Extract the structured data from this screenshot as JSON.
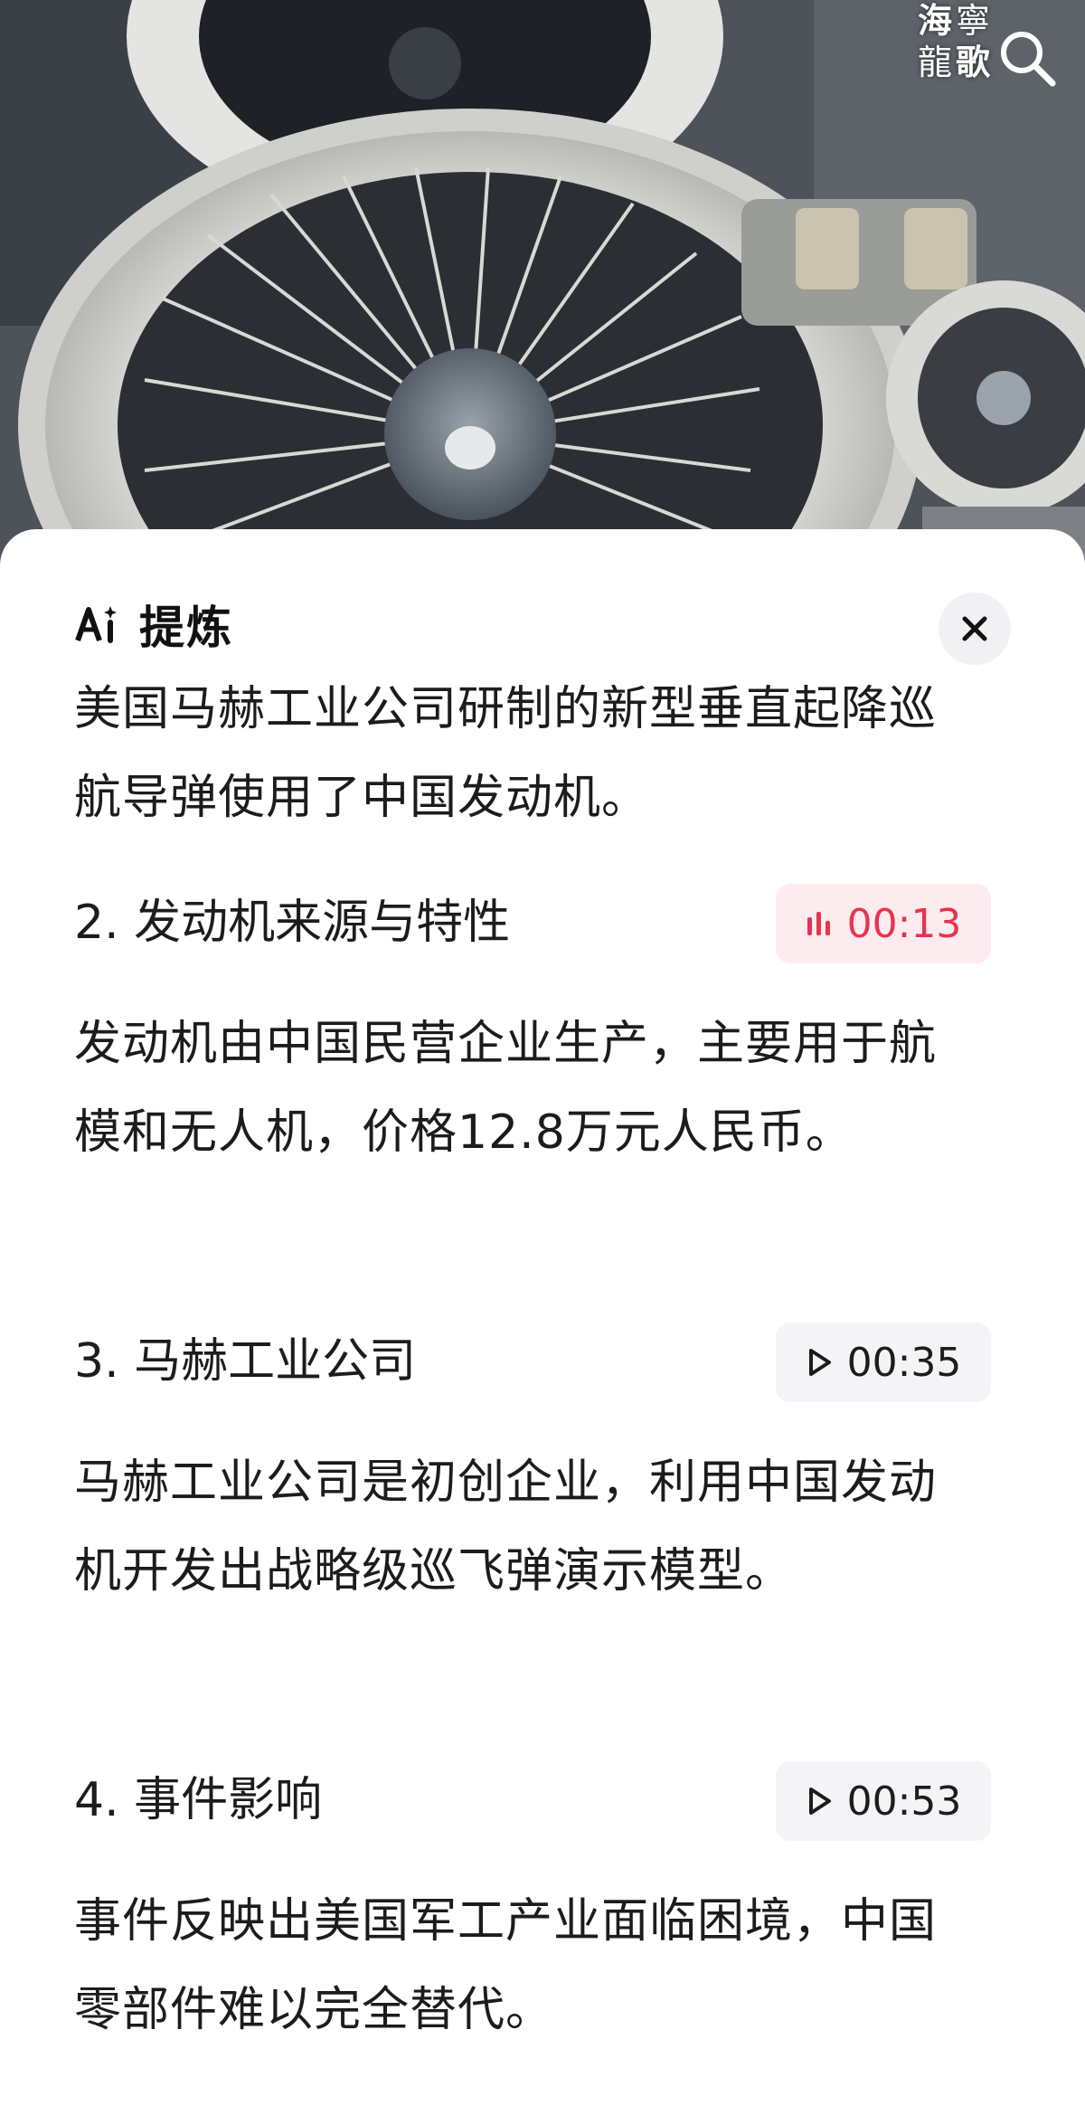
{
  "watermark": {
    "line1": [
      "海",
      "寧"
    ],
    "line2": [
      "龍",
      "歌"
    ]
  },
  "icons": {
    "search": "search-icon",
    "close": "close-icon",
    "ai": "ai-sparkle-icon",
    "playing": "audio-bars-icon",
    "play": "play-icon"
  },
  "summary": {
    "title": "提炼",
    "intro": "美国马赫工业公司研制的新型垂直起降巡航导弹使用了中国发动机。",
    "sections": [
      {
        "title": "2. 发动机来源与特性",
        "time": "00:13",
        "state": "playing",
        "text": "发动机由中国民营企业生产，主要用于航模和无人机，价格12.8万元人民币。"
      },
      {
        "title": "3. 马赫工业公司",
        "time": "00:35",
        "state": "idle",
        "text": "马赫工业公司是初创企业，利用中国发动机开发出战略级巡飞弹演示模型。"
      },
      {
        "title": "4. 事件影响",
        "time": "00:53",
        "state": "idle",
        "text": "事件反映出美国军工产业面临困境，中国零部件难以完全替代。"
      }
    ]
  },
  "colors": {
    "accent": "#e8334f",
    "accent_bg": "#fdecef",
    "button_bg": "#f4f4f6"
  }
}
